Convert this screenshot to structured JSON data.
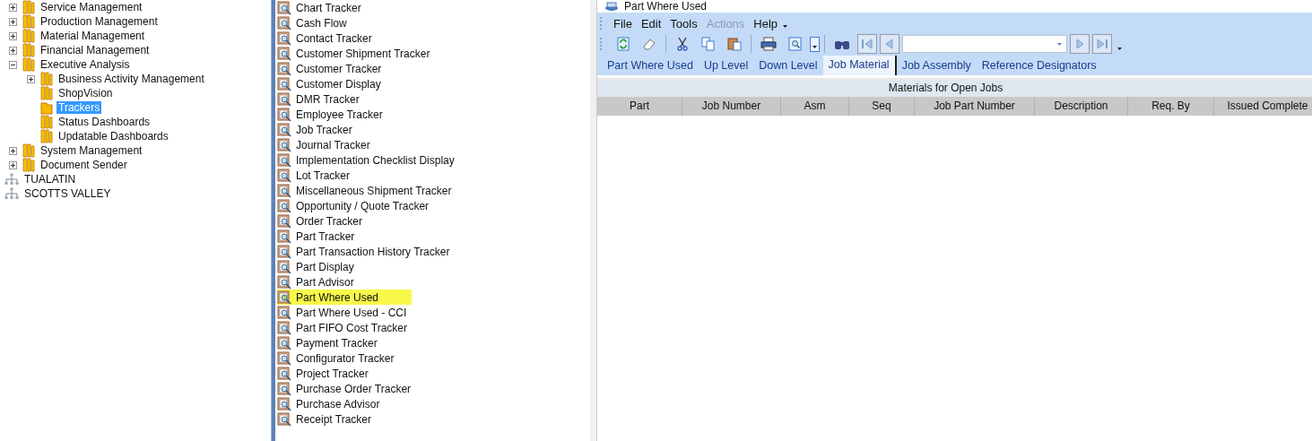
{
  "tree": [
    {
      "label": "Service Management",
      "kind": "folder",
      "selected": false,
      "expanded": false
    },
    {
      "label": "Production Management",
      "kind": "folder",
      "selected": false,
      "expanded": false
    },
    {
      "label": "Material Management",
      "kind": "folder",
      "selected": false,
      "expanded": false
    },
    {
      "label": "Financial Management",
      "kind": "folder",
      "selected": false,
      "expanded": false
    },
    {
      "label": "Executive Analysis",
      "kind": "folder",
      "selected": false,
      "expanded": true,
      "children": [
        {
          "label": "Business Activity Management",
          "kind": "folder",
          "selected": false,
          "expanded": false
        },
        {
          "label": "ShopVision",
          "kind": "folder",
          "selected": false
        },
        {
          "label": "Trackers",
          "kind": "folder",
          "selected": true
        },
        {
          "label": "Status Dashboards",
          "kind": "folder",
          "selected": false
        },
        {
          "label": "Updatable Dashboards",
          "kind": "folder",
          "selected": false
        }
      ]
    },
    {
      "label": "System Management",
      "kind": "folder",
      "selected": false,
      "expanded": false
    },
    {
      "label": "Document Sender",
      "kind": "folder",
      "selected": false,
      "expanded": false
    },
    {
      "label": "TUALATIN",
      "kind": "site",
      "selected": false
    },
    {
      "label": "SCOTTS VALLEY",
      "kind": "site",
      "selected": false
    }
  ],
  "programs": [
    {
      "label": "Chart Tracker",
      "highlighted": false
    },
    {
      "label": "Cash Flow",
      "highlighted": false
    },
    {
      "label": "Contact Tracker",
      "highlighted": false
    },
    {
      "label": "Customer Shipment Tracker",
      "highlighted": false
    },
    {
      "label": "Customer Tracker",
      "highlighted": false
    },
    {
      "label": "Customer Display",
      "highlighted": false
    },
    {
      "label": "DMR Tracker",
      "highlighted": false
    },
    {
      "label": "Employee Tracker",
      "highlighted": false
    },
    {
      "label": "Job Tracker",
      "highlighted": false
    },
    {
      "label": "Journal Tracker",
      "highlighted": false
    },
    {
      "label": "Implementation Checklist Display",
      "highlighted": false
    },
    {
      "label": "Lot Tracker",
      "highlighted": false
    },
    {
      "label": "Miscellaneous Shipment Tracker",
      "highlighted": false
    },
    {
      "label": "Opportunity / Quote Tracker",
      "highlighted": false
    },
    {
      "label": "Order Tracker",
      "highlighted": false
    },
    {
      "label": "Part Tracker",
      "highlighted": false
    },
    {
      "label": "Part Transaction History Tracker",
      "highlighted": false
    },
    {
      "label": "Part Display",
      "highlighted": false
    },
    {
      "label": "Part Advisor",
      "highlighted": false
    },
    {
      "label": "Part Where Used",
      "highlighted": true
    },
    {
      "label": "Part Where Used - CCI",
      "highlighted": false
    },
    {
      "label": "Part FIFO Cost Tracker",
      "highlighted": false
    },
    {
      "label": "Payment Tracker",
      "highlighted": false
    },
    {
      "label": "Configurator Tracker",
      "highlighted": false
    },
    {
      "label": "Project Tracker",
      "highlighted": false
    },
    {
      "label": "Purchase Order Tracker",
      "highlighted": false
    },
    {
      "label": "Purchase Advisor",
      "highlighted": false
    },
    {
      "label": "Receipt Tracker",
      "highlighted": false
    }
  ],
  "window": {
    "title": "Part Where Used",
    "menu": [
      {
        "label": "File",
        "disabled": false
      },
      {
        "label": "Edit",
        "disabled": false
      },
      {
        "label": "Tools",
        "disabled": false
      },
      {
        "label": "Actions",
        "disabled": true
      },
      {
        "label": "Help",
        "disabled": false
      }
    ],
    "tabs": [
      {
        "label": "Part Where Used",
        "selected": false
      },
      {
        "label": "Up Level",
        "selected": false
      },
      {
        "label": "Down Level",
        "selected": false
      },
      {
        "label": "Job Material",
        "selected": true
      },
      {
        "label": "Job Assembly",
        "selected": false
      },
      {
        "label": "Reference Designators",
        "selected": false
      }
    ],
    "grid": {
      "title": "Materials for Open Jobs",
      "columns": [
        "Part",
        "Job Number",
        "Asm",
        "Seq",
        "Job Part Number",
        "Description",
        "Req. By",
        "Issued Complete"
      ]
    }
  }
}
